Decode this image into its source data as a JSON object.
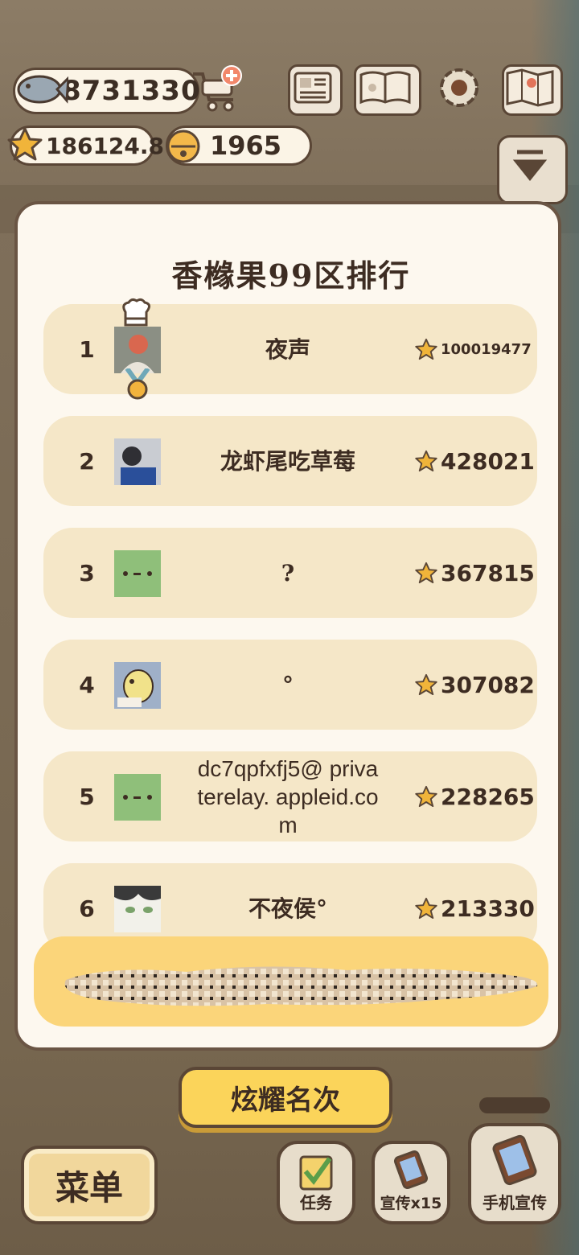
{
  "currency": {
    "fish": "8731330",
    "stars": "186124.8",
    "bells": "1965"
  },
  "leaderboard": {
    "title": "香橼果99区排行",
    "rows": [
      {
        "rank": "1",
        "name": "夜声",
        "score": "100019477"
      },
      {
        "rank": "2",
        "name": "龙虾尾吃草莓",
        "score": "428021"
      },
      {
        "rank": "3",
        "name": "?",
        "score": "367815"
      },
      {
        "rank": "4",
        "name": "°",
        "score": "307082"
      },
      {
        "rank": "5",
        "name": "dc7qpfxfj5@ privaterelay. appleid.com",
        "score": "228265"
      },
      {
        "rank": "6",
        "name": "不夜侯°",
        "score": "213330"
      }
    ]
  },
  "buttons": {
    "brag": "炫耀名次",
    "menu": "菜单",
    "tasks": "任务",
    "promote": "宣传x15",
    "phone_promote": "手机宣传"
  },
  "icons": {
    "fish": "fish-icon",
    "cart": "cart-add-icon",
    "star": "star-icon",
    "bell": "bell-icon",
    "news": "newspaper-icon",
    "book": "paw-book-icon",
    "settings": "gear-icon",
    "map": "map-icon"
  },
  "colors": {
    "row_bg": "#f5e7c8",
    "my_row_bg": "#fbd57a",
    "brag_button": "#fbd45a",
    "outline": "#5a4636"
  }
}
